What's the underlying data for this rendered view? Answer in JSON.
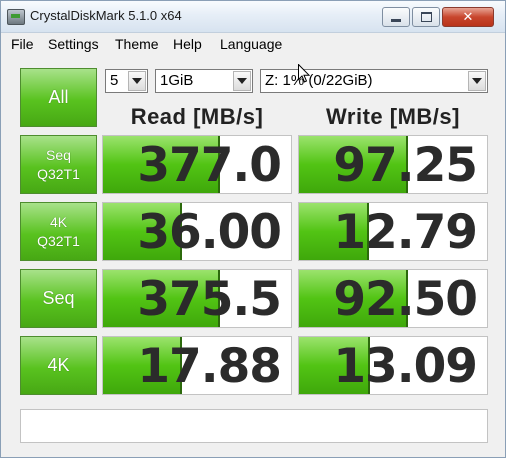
{
  "window": {
    "title": "CrystalDiskMark 5.1.0 x64",
    "minimize_glyph": "",
    "maximize_glyph": "",
    "close_glyph": "✕"
  },
  "menu": [
    {
      "label": "File"
    },
    {
      "label": "Settings"
    },
    {
      "label": "Theme"
    },
    {
      "label": "Help"
    },
    {
      "label": "Language"
    }
  ],
  "controls": {
    "all_label": "All",
    "count": "5",
    "size": "1GiB",
    "drive": "Z: 1% (0/22GiB)"
  },
  "headers": {
    "read": "Read [MB/s]",
    "write": "Write [MB/s]"
  },
  "tests": [
    {
      "line1": "Seq",
      "line2": "Q32T1",
      "read": "377.0",
      "write": "97.25",
      "read_fill": 0.62,
      "write_fill": 0.58
    },
    {
      "line1": "4K",
      "line2": "Q32T1",
      "read": "36.00",
      "write": "12.79",
      "read_fill": 0.42,
      "write_fill": 0.37
    },
    {
      "line1": "Seq",
      "line2": "",
      "read": "375.5",
      "write": "92.50",
      "read_fill": 0.62,
      "write_fill": 0.58
    },
    {
      "line1": "4K",
      "line2": "",
      "read": "17.88",
      "write": "13.09",
      "read_fill": 0.42,
      "write_fill": 0.38
    }
  ],
  "status_text": "",
  "colors": {
    "accent_green": "#52c414",
    "button_green": "#59c21f"
  }
}
